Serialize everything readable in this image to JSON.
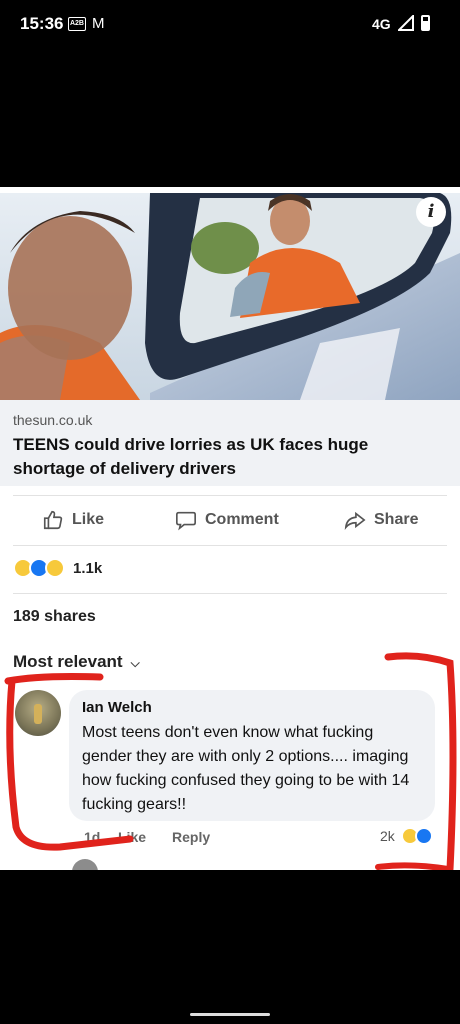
{
  "status_bar": {
    "time": "15:36",
    "badge": "A2B",
    "network": "4G"
  },
  "icons": {
    "info": "info-icon",
    "like": "thumbs-up-icon",
    "comment": "speech-bubble-icon",
    "share": "share-arrow-icon",
    "sort": "chevron-down-icon",
    "mail": "gmail-icon"
  },
  "post": {
    "image_info_glyph": "i",
    "link": {
      "domain": "thesun.co.uk",
      "title": "TEENS could drive lorries as UK faces huge shortage of delivery drivers"
    },
    "actions": {
      "like": "Like",
      "comment": "Comment",
      "share": "Share"
    },
    "reaction_count": "1.1k",
    "shares": "189 shares"
  },
  "comments": {
    "sort_label": "Most relevant",
    "items": [
      {
        "author": "Ian Welch",
        "text": "Most teens don't even know what fucking gender they are with only 2 options.... imaging how fucking confused they going to be with 14 fucking gears!!",
        "time": "1d",
        "like": "Like",
        "reply": "Reply",
        "reaction_count": "2k"
      }
    ]
  },
  "colors": {
    "like_blue": "#1877f2",
    "haha_yellow": "#f7c93b",
    "annotation_red": "#e0231c"
  }
}
